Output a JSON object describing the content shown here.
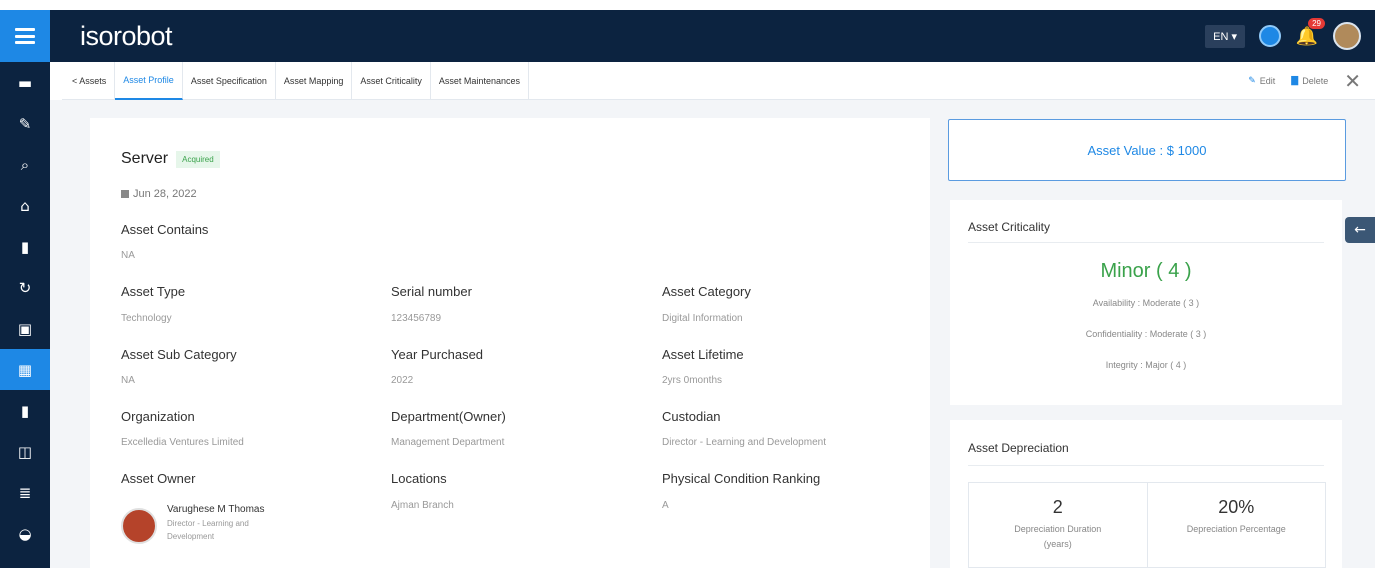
{
  "app": {
    "logo": "isorobot"
  },
  "header": {
    "language": "EN ▾",
    "notification_count": "29"
  },
  "sidebar": {
    "items": [
      {
        "icon": "inbox-icon",
        "glyph": "▬"
      },
      {
        "icon": "edit-icon",
        "glyph": "✎"
      },
      {
        "icon": "search-icon",
        "glyph": "⌕"
      },
      {
        "icon": "home-icon",
        "glyph": "⌂"
      },
      {
        "icon": "document-icon",
        "glyph": "▮"
      },
      {
        "icon": "refresh-icon",
        "glyph": "↻"
      },
      {
        "icon": "id-card-icon",
        "glyph": "▣"
      },
      {
        "icon": "building-icon",
        "glyph": "▦"
      },
      {
        "icon": "file-icon",
        "glyph": "▮"
      },
      {
        "icon": "presentation-icon",
        "glyph": "◫"
      },
      {
        "icon": "list-icon",
        "glyph": "≣"
      },
      {
        "icon": "dashboard-icon",
        "glyph": "◒"
      }
    ]
  },
  "tabs": {
    "back": "< Assets",
    "items": [
      "Asset Profile",
      "Asset Specification",
      "Asset Mapping",
      "Asset Criticality",
      "Asset Maintenances"
    ],
    "edit": "Edit",
    "delete": "Delete"
  },
  "asset": {
    "name": "Server",
    "status": "Acquired",
    "date": "Jun 28, 2022",
    "contains_label": "Asset Contains",
    "contains_value": "NA",
    "fields": {
      "asset_type": {
        "label": "Asset Type",
        "value": "Technology"
      },
      "serial_number": {
        "label": "Serial number",
        "value": "123456789"
      },
      "asset_category": {
        "label": "Asset Category",
        "value": "Digital Information"
      },
      "sub_category": {
        "label": "Asset Sub Category",
        "value": "NA"
      },
      "year_purchased": {
        "label": "Year Purchased",
        "value": "2022"
      },
      "lifetime": {
        "label": "Asset Lifetime",
        "value": "2yrs 0months"
      },
      "organization": {
        "label": "Organization",
        "value": "Excelledia Ventures Limited"
      },
      "department": {
        "label": "Department(Owner)",
        "value": "Management Department"
      },
      "custodian": {
        "label": "Custodian",
        "value": "Director - Learning and Development"
      },
      "owner": {
        "label": "Asset Owner"
      },
      "locations": {
        "label": "Locations",
        "value": "Ajman Branch"
      },
      "condition": {
        "label": "Physical Condition Ranking",
        "value": "A"
      }
    },
    "owner": {
      "name": "Varughese M Thomas",
      "role": "Director - Learning and Development"
    }
  },
  "value_panel": {
    "text": "Asset Value : $ 1000"
  },
  "criticality": {
    "title": "Asset Criticality",
    "level": "Minor ( 4 )",
    "availability": "Availability : Moderate ( 3 )",
    "confidentiality": "Confidentiality : Moderate ( 3 )",
    "integrity": "Integrity : Major ( 4 )"
  },
  "depreciation": {
    "title": "Asset Depreciation",
    "duration_value": "2",
    "duration_label": "Depreciation Duration (years)",
    "percentage_value": "20%",
    "percentage_label": "Depreciation Percentage"
  },
  "colors": {
    "navy": "#0c2340",
    "accent": "#1e88e5",
    "success": "#3aa24b"
  }
}
